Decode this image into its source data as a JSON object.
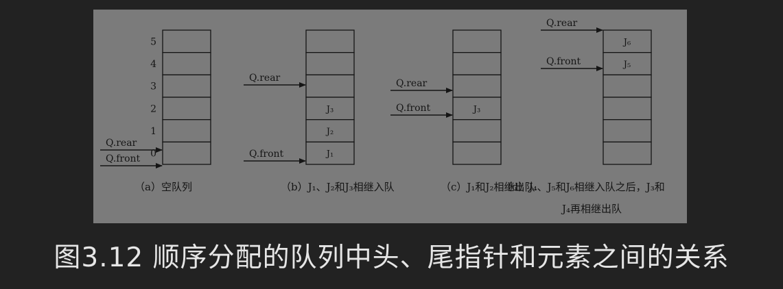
{
  "figure": {
    "index_labels": [
      "5",
      "4",
      "3",
      "2",
      "1",
      "0"
    ],
    "queues": [
      {
        "caption": "（a）空队列",
        "cells": [
          "",
          "",
          "",
          "",
          "",
          ""
        ],
        "pointers": [
          {
            "label": "Q.rear",
            "slot": 0
          },
          {
            "label": "Q.front",
            "slot": 0
          }
        ]
      },
      {
        "caption": "（b）J₁、J₂和J₃相继入队",
        "cells": [
          "",
          "",
          "",
          "J₃",
          "J₂",
          "J₁"
        ],
        "pointers": [
          {
            "label": "Q.rear",
            "slot": 3
          },
          {
            "label": "Q.front",
            "slot": 0
          }
        ]
      },
      {
        "caption": "（c）J₁和J₂相继出队",
        "cells": [
          "",
          "",
          "",
          "J₃",
          "",
          ""
        ],
        "pointers": [
          {
            "label": "Q.rear",
            "slot": 3
          },
          {
            "label": "Q.front",
            "slot": 2
          }
        ]
      },
      {
        "caption": "（d）J₄、J₅和J₆相继入队之后，J₃和",
        "caption_line2": "J₄再相继出队",
        "cells": [
          "J₆",
          "J₅",
          "",
          "",
          "",
          ""
        ],
        "pointers": [
          {
            "label": "Q.rear",
            "slot": 6
          },
          {
            "label": "Q.front",
            "slot": 5
          }
        ]
      }
    ]
  },
  "caption": "图3.12 顺序分配的队列中头、尾指针和元素之间的关系"
}
